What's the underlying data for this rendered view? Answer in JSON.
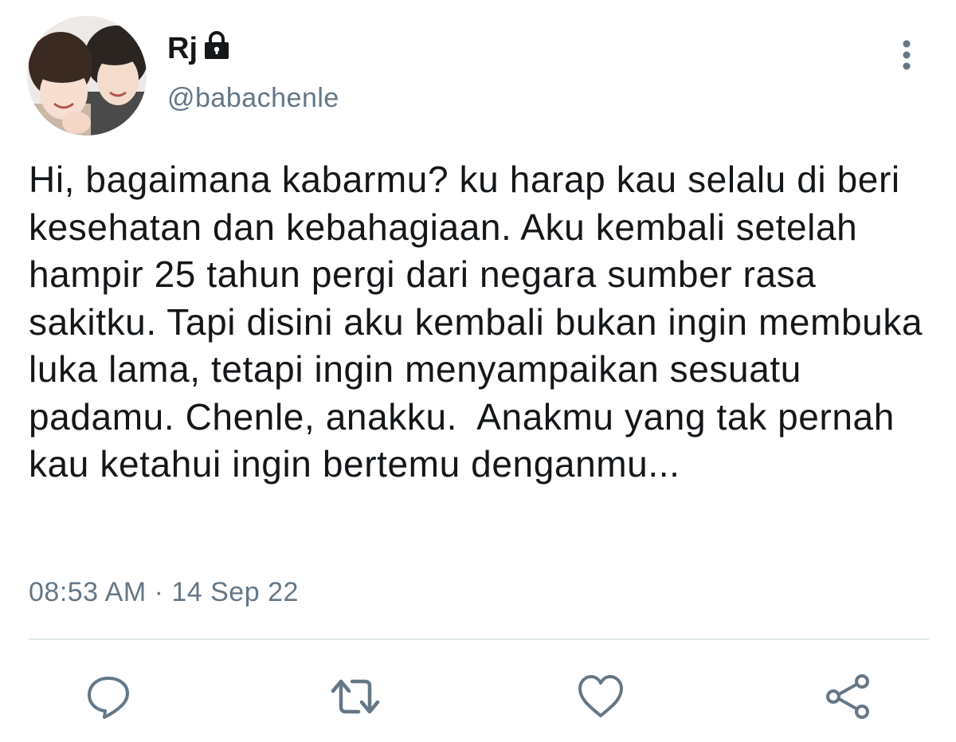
{
  "user": {
    "display_name": "Rj",
    "handle": "@babachenle",
    "avatar_icon": "profile-photo",
    "protected_icon": "lock-icon"
  },
  "tweet": {
    "text": "Hi, bagaimana kabarmu? ku harap kau selalu di beri kesehatan dan kebahagiaan. Aku kembali setelah hampir 25 tahun pergi dari negara sumber rasa sakitku. Tapi disini aku kembali bukan ingin membuka luka lama, tetapi ingin menyampaikan sesuatu padamu. Chenle, anakku.  Anakmu yang tak pernah kau ketahui ingin bertemu denganmu...",
    "timestamp": "08:53 AM · 14 Sep 22"
  },
  "actions": {
    "reply_icon": "reply-icon",
    "retweet_icon": "retweet-icon",
    "like_icon": "heart-icon",
    "share_icon": "share-icon",
    "more_icon": "more-vertical-icon"
  },
  "colors": {
    "text": "#14171a",
    "secondary": "#657786",
    "divider": "#e1e8ed"
  }
}
